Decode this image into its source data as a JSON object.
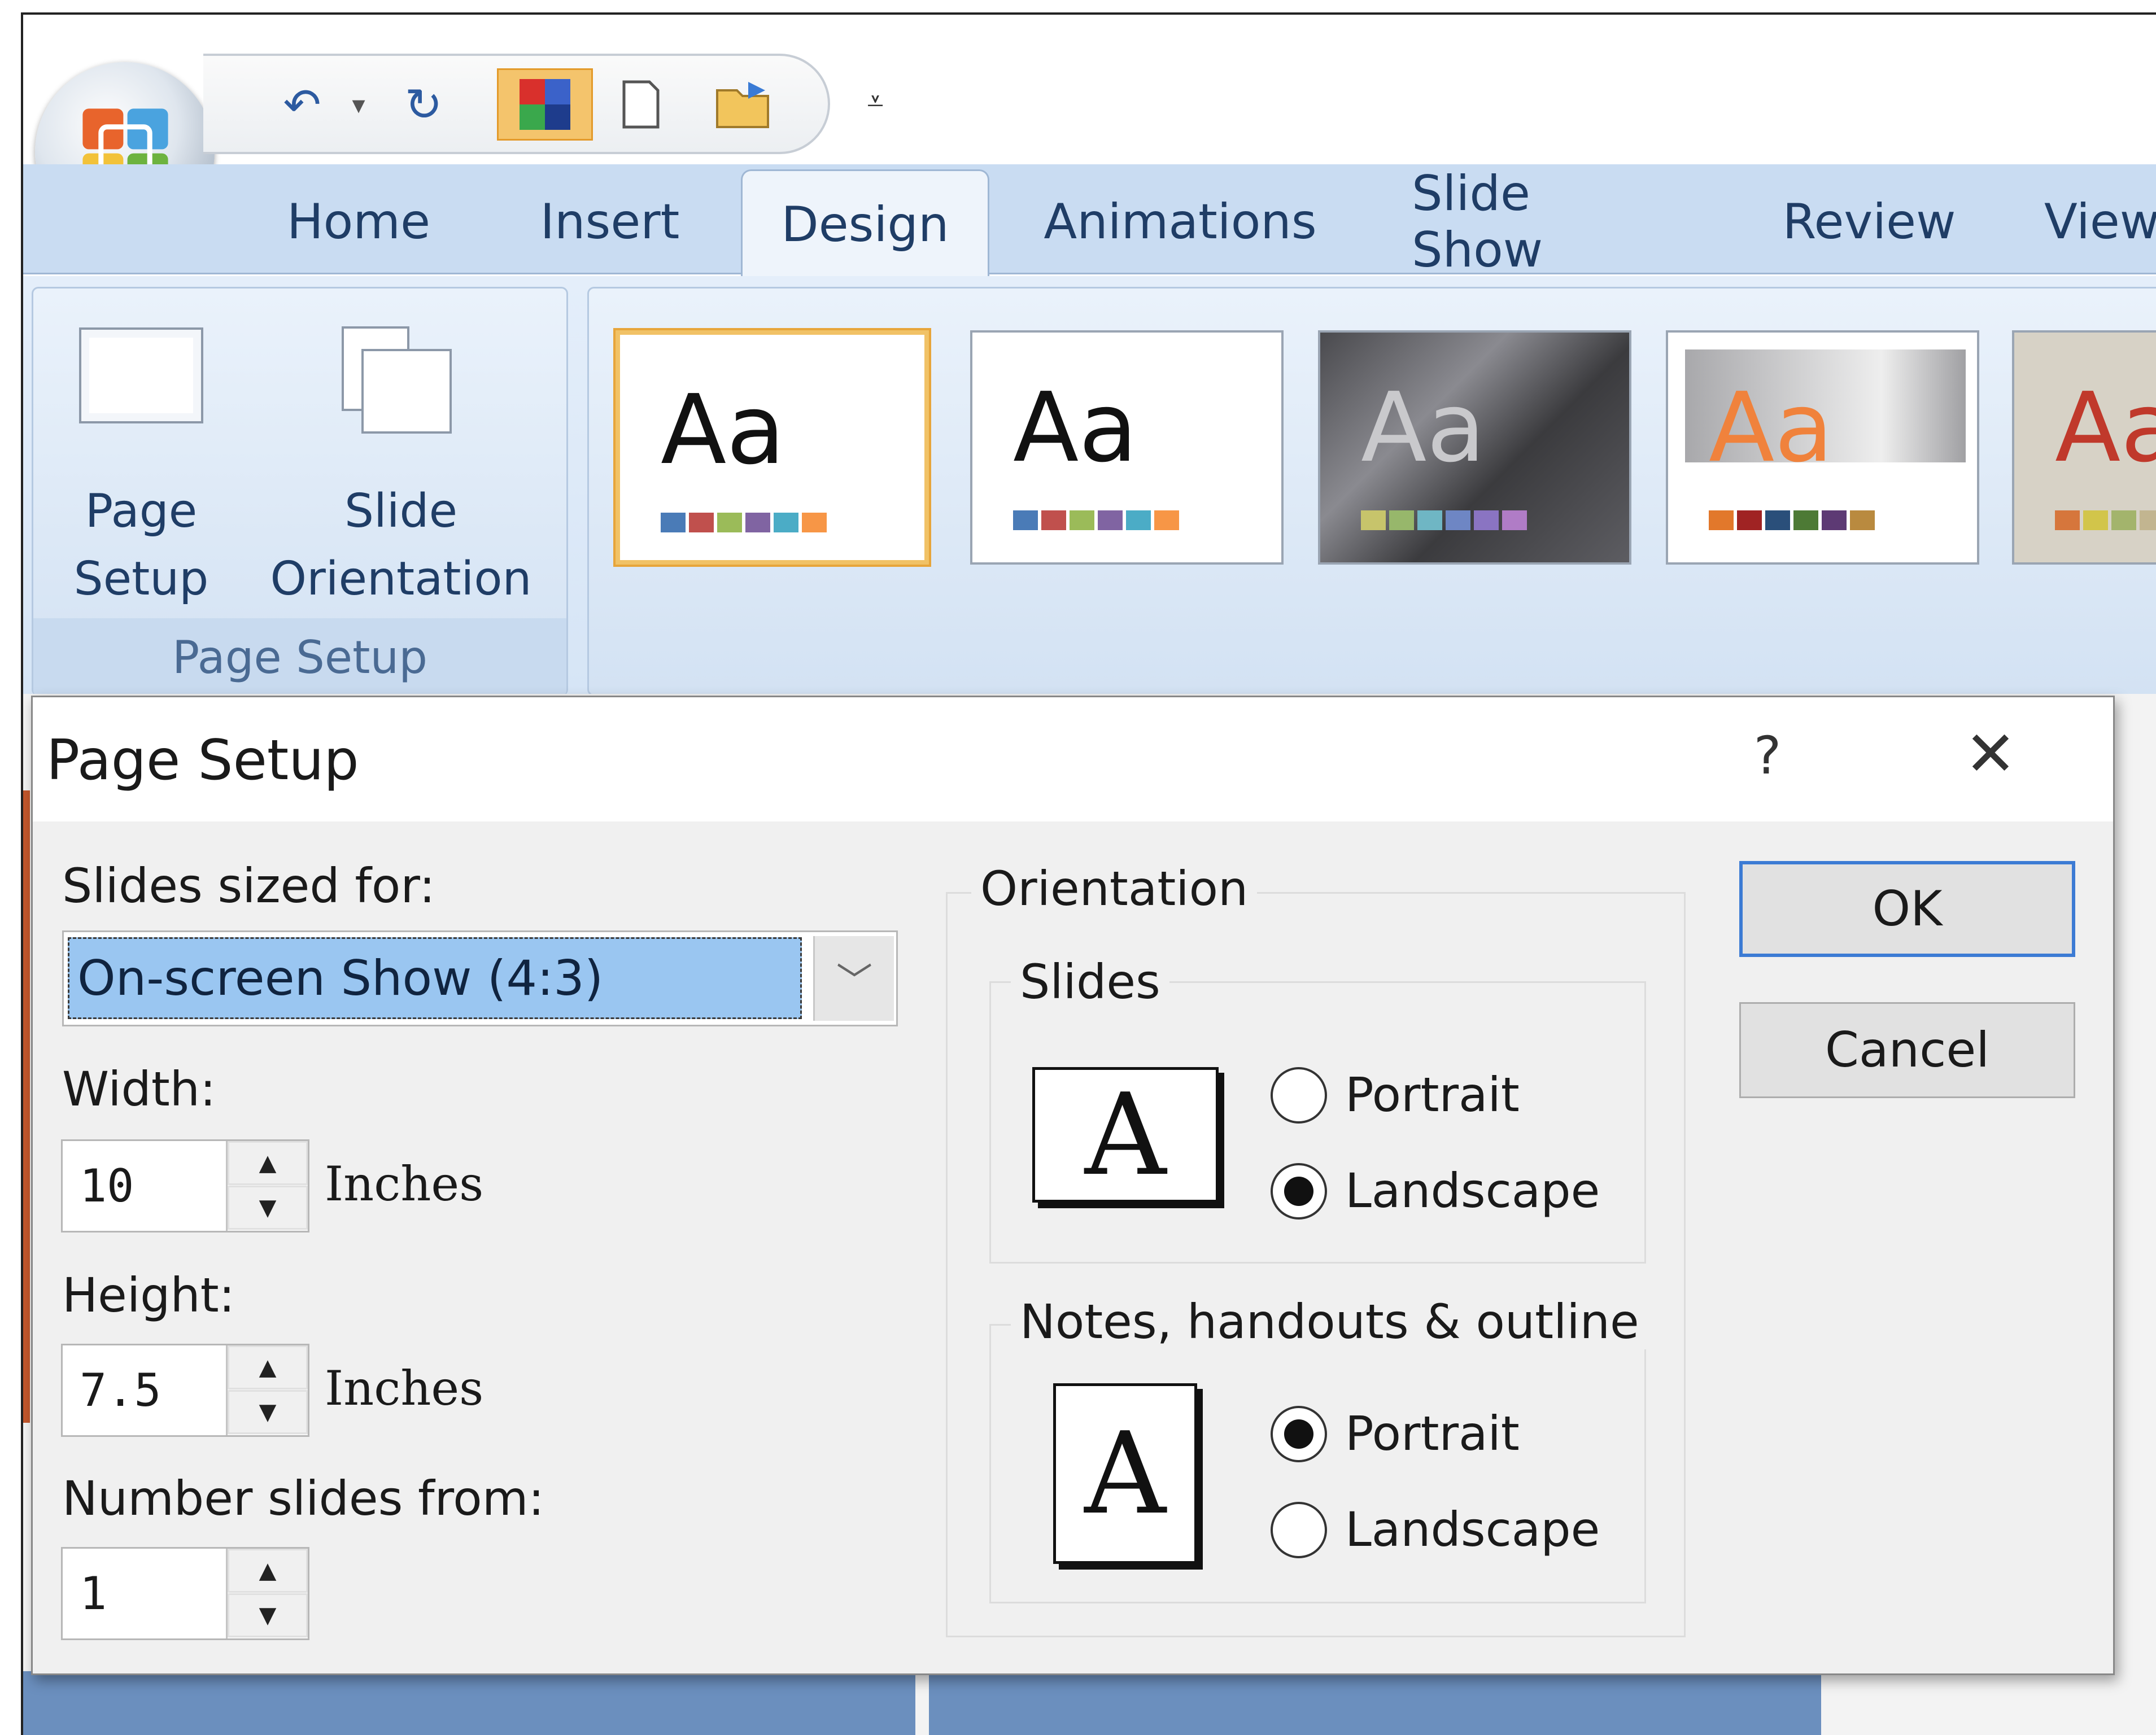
{
  "qat": {
    "undo_icon": "undo-icon",
    "undo_dropdown_icon": "dropdown-arrow-icon",
    "redo_icon": "redo-icon",
    "theme_icon": "theme-colors-icon",
    "new_icon": "new-slide-icon",
    "open_icon": "open-folder-icon",
    "customize_icon": "customize-qat-icon"
  },
  "tabs": [
    "Home",
    "Insert",
    "Design",
    "Animations",
    "Slide Show",
    "Review",
    "View"
  ],
  "ribbon": {
    "page_setup_button": "Page Setup",
    "slide_orientation_button": "Slide Orientation",
    "group_label": "Page Setup",
    "themes": [
      {
        "label": "Aa",
        "text_color": "#111111",
        "bars": [
          "#4a7bb7",
          "#c0504d",
          "#9bbb59",
          "#8064a2",
          "#4bacc6",
          "#f79646"
        ]
      },
      {
        "label": "Aa",
        "text_color": "#111111",
        "bars": [
          "#4a7bb7",
          "#c0504d",
          "#9bbb59",
          "#8064a2",
          "#4bacc6",
          "#f79646"
        ]
      },
      {
        "label": "Aa",
        "text_color": "#c9c9cc",
        "bars": [
          "#c7c46b",
          "#97b76b",
          "#6fb6c4",
          "#6e86c4",
          "#8a74c2",
          "#b07cc6"
        ]
      },
      {
        "label": "Aa",
        "text_color": "#f0823c",
        "bars": [
          "#e2782b",
          "#a02323",
          "#2a4f7a",
          "#4d7a35",
          "#5d3a74",
          "#b98a3f"
        ]
      },
      {
        "label": "Aa",
        "text_color": "#c0392b",
        "bars": [
          "#d6763c",
          "#d2c54a",
          "#a3b46c",
          "#c2b590"
        ]
      }
    ]
  },
  "dialog": {
    "title": "Page Setup",
    "help": "?",
    "close": "✕",
    "slides_sized_for_label": "Slides sized for:",
    "slides_sized_for_value": "On-screen Show (4:3)",
    "width_label": "Width:",
    "width_value": "10",
    "width_unit": "Inches",
    "height_label": "Height:",
    "height_value": "7.5",
    "height_unit": "Inches",
    "number_from_label": "Number slides from:",
    "number_from_value": "1",
    "orientation_label": "Orientation",
    "slides_group_label": "Slides",
    "slides_options": {
      "portrait": "Portrait",
      "landscape": "Landscape",
      "selected": "Landscape"
    },
    "notes_group_label": "Notes, handouts & outline",
    "notes_options": {
      "portrait": "Portrait",
      "landscape": "Landscape",
      "selected": "Portrait"
    },
    "page_icon_glyph": "A",
    "ok": "OK",
    "cancel": "Cancel"
  }
}
